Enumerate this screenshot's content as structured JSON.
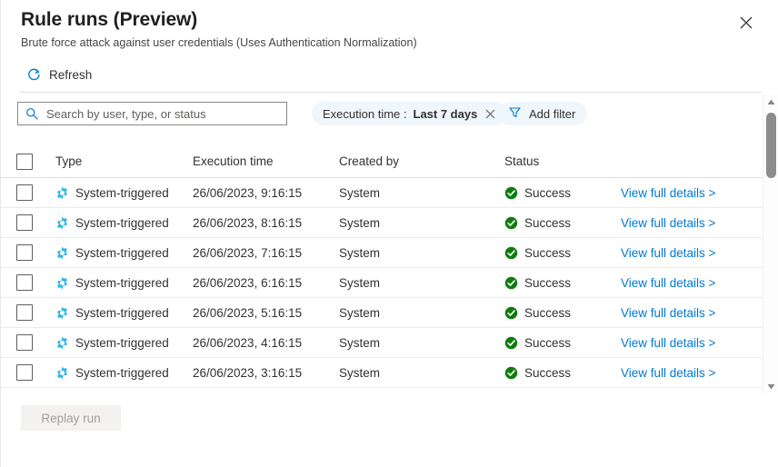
{
  "header": {
    "title": "Rule runs (Preview)",
    "subtitle": "Brute force attack against user credentials (Uses Authentication Normalization)",
    "close_label": "close-icon"
  },
  "commandbar": {
    "refresh_label": "Refresh"
  },
  "search": {
    "placeholder": "Search by user, type, or status",
    "value": ""
  },
  "filters": {
    "chip": {
      "field": "Execution time :",
      "value": "Last 7 days"
    },
    "add_filter_label": "Add filter"
  },
  "table": {
    "columns": [
      "Type",
      "Execution time",
      "Created by",
      "Status"
    ],
    "link_label": "View full details >",
    "rows": [
      {
        "type": "System-triggered",
        "time": "26/06/2023, 9:16:15",
        "user": "System",
        "status": "Success"
      },
      {
        "type": "System-triggered",
        "time": "26/06/2023, 8:16:15",
        "user": "System",
        "status": "Success"
      },
      {
        "type": "System-triggered",
        "time": "26/06/2023, 7:16:15",
        "user": "System",
        "status": "Success"
      },
      {
        "type": "System-triggered",
        "time": "26/06/2023, 6:16:15",
        "user": "System",
        "status": "Success"
      },
      {
        "type": "System-triggered",
        "time": "26/06/2023, 5:16:15",
        "user": "System",
        "status": "Success"
      },
      {
        "type": "System-triggered",
        "time": "26/06/2023, 4:16:15",
        "user": "System",
        "status": "Success"
      },
      {
        "type": "System-triggered",
        "time": "26/06/2023, 3:16:15",
        "user": "System",
        "status": "Success"
      }
    ]
  },
  "footer": {
    "replay_label": "Replay run"
  },
  "colors": {
    "accent": "#0078d4",
    "success": "#107c10",
    "gear": "#32b8e8",
    "pill_bg": "#eff6fc"
  }
}
